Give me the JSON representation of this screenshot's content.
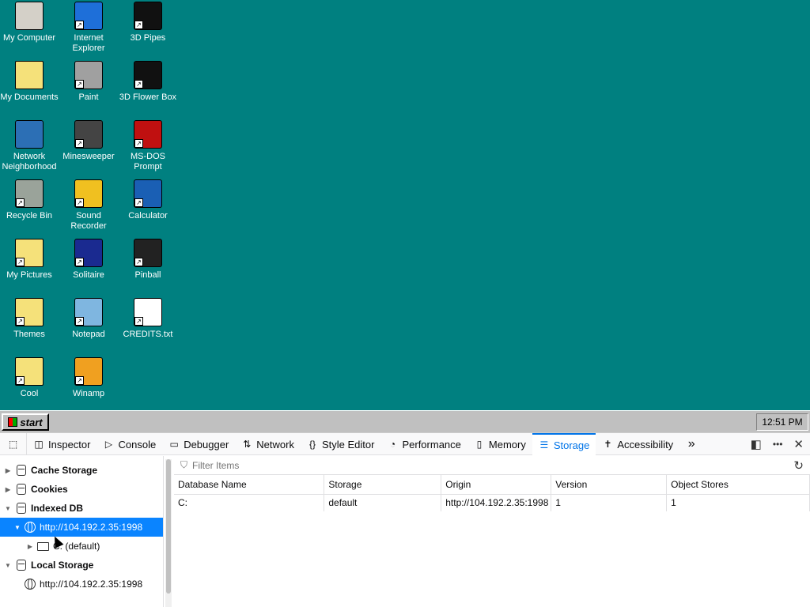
{
  "desktop": {
    "icons": [
      {
        "label": "My Computer",
        "icon": "computer-icon",
        "color": "#d4d0c8"
      },
      {
        "label": "Internet\nExplorer",
        "icon": "ie-icon",
        "color": "#1e6fd9"
      },
      {
        "label": "3D Pipes",
        "icon": "screensaver-icon",
        "color": "#111111"
      },
      {
        "label": "My Documents",
        "icon": "folder-docs-icon",
        "color": "#f5e17a"
      },
      {
        "label": "Paint",
        "icon": "paint-icon",
        "color": "#a0a0a0"
      },
      {
        "label": "3D Flower Box",
        "icon": "screensaver-icon",
        "color": "#111111"
      },
      {
        "label": "Network\nNeighborhood",
        "icon": "network-icon",
        "color": "#2c6fb5"
      },
      {
        "label": "Minesweeper",
        "icon": "mine-icon",
        "color": "#444444"
      },
      {
        "label": "MS-DOS\nPrompt",
        "icon": "msdos-icon",
        "color": "#c01010"
      },
      {
        "label": "Recycle Bin",
        "icon": "recycle-bin-icon",
        "color": "#9aa39a"
      },
      {
        "label": "Sound\nRecorder",
        "icon": "sound-icon",
        "color": "#f0c020"
      },
      {
        "label": "Calculator",
        "icon": "calculator-icon",
        "color": "#1a5fb4"
      },
      {
        "label": "My Pictures",
        "icon": "folder-icon",
        "color": "#f5e17a"
      },
      {
        "label": "Solitaire",
        "icon": "solitaire-icon",
        "color": "#1a2a90"
      },
      {
        "label": "Pinball",
        "icon": "pinball-icon",
        "color": "#222222"
      },
      {
        "label": "Themes",
        "icon": "folder-icon",
        "color": "#f5e17a"
      },
      {
        "label": "Notepad",
        "icon": "notepad-icon",
        "color": "#7fb6e0"
      },
      {
        "label": "CREDITS.txt",
        "icon": "text-file-icon",
        "color": "#ffffff"
      },
      {
        "label": "Cool",
        "icon": "folder-icon",
        "color": "#f5e17a"
      },
      {
        "label": "Winamp",
        "icon": "winamp-icon",
        "color": "#f0a020"
      }
    ]
  },
  "taskbar": {
    "start_label": "start",
    "clock": "12:51 PM"
  },
  "devtools": {
    "tabs": [
      {
        "label": "Inspector",
        "icon": "◫"
      },
      {
        "label": "Console",
        "icon": "▷"
      },
      {
        "label": "Debugger",
        "icon": "▭"
      },
      {
        "label": "Network",
        "icon": "⇅"
      },
      {
        "label": "Style Editor",
        "icon": "{}"
      },
      {
        "label": "Performance",
        "icon": "◔"
      },
      {
        "label": "Memory",
        "icon": "▯"
      },
      {
        "label": "Storage",
        "icon": "☰"
      },
      {
        "label": "Accessibility",
        "icon": "✝"
      }
    ],
    "active_tab": "Storage",
    "more_tabs": "»",
    "dock_icon": "◧",
    "menu_icon": "•••",
    "close_icon": "✕",
    "tree": {
      "cache_storage": "Cache Storage",
      "cookies": "Cookies",
      "indexed_db": "Indexed DB",
      "idb_origin": "http://104.192.2.35:1998",
      "idb_db": "C: (default)",
      "local_storage": "Local Storage",
      "ls_origin": "http://104.192.2.35:1998"
    },
    "filter_placeholder": "Filter Items",
    "table": {
      "headers": [
        "Database Name",
        "Storage",
        "Origin",
        "Version",
        "Object Stores"
      ],
      "rows": [
        [
          "C:",
          "default",
          "http://104.192.2.35:1998",
          "1",
          "1"
        ]
      ]
    }
  }
}
